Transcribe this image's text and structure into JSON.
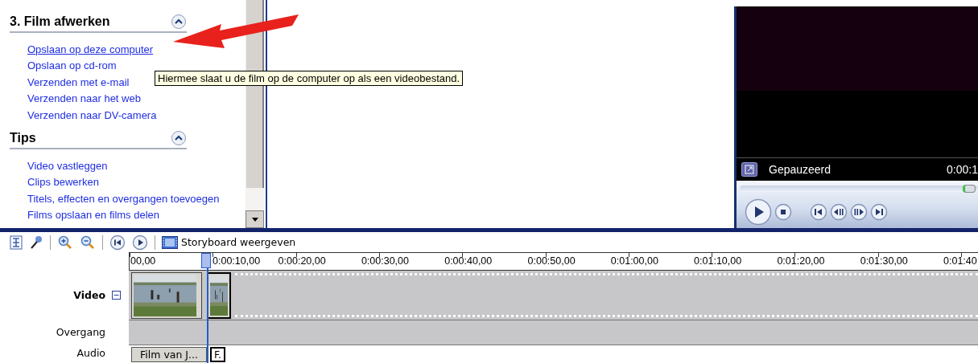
{
  "task_panel": {
    "sections": [
      {
        "title": "3. Film afwerken",
        "expanded": true,
        "links": [
          {
            "label": "Opslaan op deze computer",
            "hovered": true
          },
          {
            "label": "Opslaan op cd-rom",
            "hovered": false
          },
          {
            "label": "Verzenden met e-mail",
            "hovered": false
          },
          {
            "label": "Verzenden naar het web",
            "hovered": false
          },
          {
            "label": "Verzenden naar DV-camera",
            "hovered": false
          }
        ]
      },
      {
        "title": "Tips",
        "expanded": true,
        "links": [
          {
            "label": "Video vastleggen",
            "hovered": false
          },
          {
            "label": "Clips bewerken",
            "hovered": false
          },
          {
            "label": "Titels, effecten en overgangen toevoegen",
            "hovered": false
          },
          {
            "label": "Films opslaan en films delen",
            "hovered": false
          }
        ]
      }
    ]
  },
  "tooltip": {
    "text": "Hiermee slaat u de film op de computer op als een videobestand."
  },
  "monitor": {
    "status": "Gepauzeerd",
    "time": "0:00:1",
    "level": 0.97
  },
  "toolbar": {
    "storyboard_label": "Storyboard weergeven"
  },
  "timeline": {
    "ticks": [
      "00,00",
      "0:00:10,00",
      "0:00:20,00",
      "0:00:30,00",
      "0:00:40,00",
      "0:00:50,00",
      "0:01:00,00",
      "0:01:10,00",
      "0:01:20,00",
      "0:01:30,00",
      "0:01:40"
    ],
    "tracks": [
      {
        "label": "Video",
        "kind": "video",
        "expanded": true
      },
      {
        "label": "Overgang",
        "kind": "transition"
      },
      {
        "label": "Audio",
        "kind": "audio",
        "clips": [
          {
            "label": "Film van J..."
          },
          {
            "label": "F."
          }
        ]
      }
    ]
  }
}
